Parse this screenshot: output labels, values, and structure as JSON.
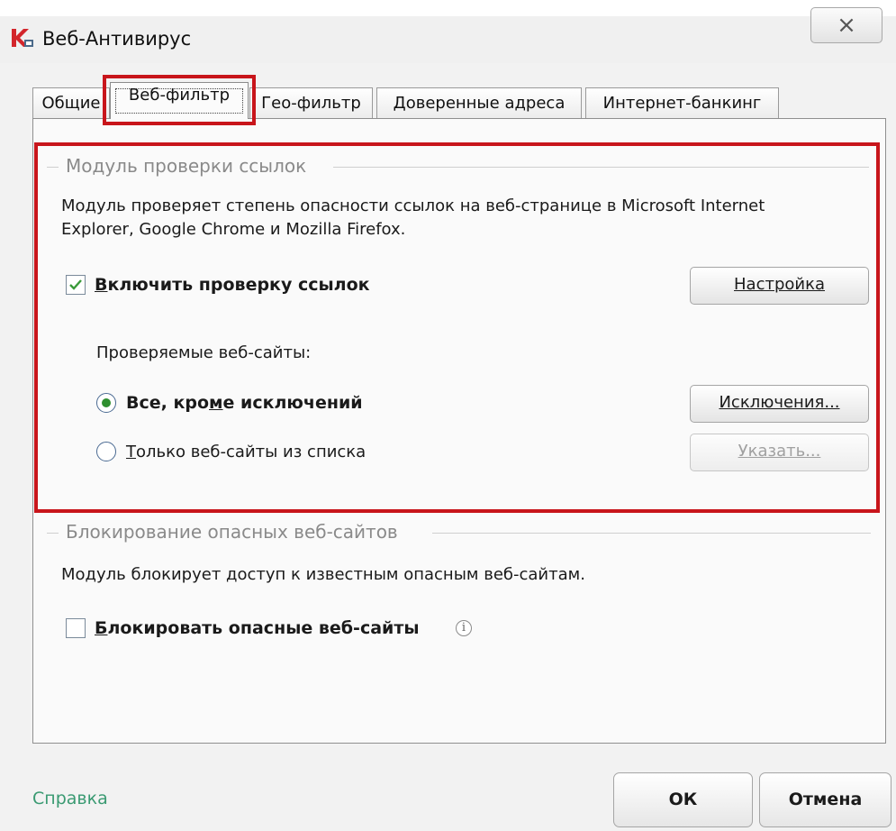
{
  "window": {
    "title": "Веб-Антивирус",
    "close_label": "×"
  },
  "tabs": [
    {
      "label": "Общие"
    },
    {
      "label": "Веб-фильтр",
      "active": true
    },
    {
      "label": "Гео-фильтр"
    },
    {
      "label": "Доверенные адреса"
    },
    {
      "label": "Интернет-банкинг"
    }
  ],
  "link_check": {
    "heading": "Модуль проверки ссылок",
    "description_line1": "Модуль проверяет степень опасности ссылок на веб-странице в Microsoft Internet",
    "description_line2": "Explorer, Google Chrome и Mozilla Firefox.",
    "enable": {
      "label_hotkey": "В",
      "label_rest": "ключить проверку ссылок",
      "checked": true
    },
    "settings_button": {
      "hotkey": "Н",
      "rest": "астройка"
    },
    "sites_label": "Проверяемые веб-сайты:",
    "option_all": {
      "label_before": "Все, кро",
      "label_hotkey": "м",
      "label_after": "е исключений",
      "selected": true
    },
    "exceptions_button": {
      "hotkey": "И",
      "rest": "сключения..."
    },
    "option_list": {
      "label_hotkey": "Т",
      "label_rest": "олько веб-сайты из списка",
      "selected": false
    },
    "specify_button": {
      "hotkey": "У",
      "rest": "казать...",
      "disabled": true
    }
  },
  "blocking": {
    "heading": "Блокирование опасных веб-сайтов",
    "description": "Модуль блокирует доступ к известным опасным веб-сайтам.",
    "block": {
      "label_hotkey": "Б",
      "label_rest": "локировать опасные веб-сайты",
      "checked": false,
      "info_glyph": "i"
    }
  },
  "footer": {
    "help": "Справка",
    "ok": "ОК",
    "cancel": "Отмена"
  },
  "colors": {
    "highlight": "#c8151b",
    "check": "#3a9a3a",
    "radio_dot": "#2f8f2f",
    "help_link": "#3a9a72",
    "group_heading": "#8a8a8a"
  }
}
